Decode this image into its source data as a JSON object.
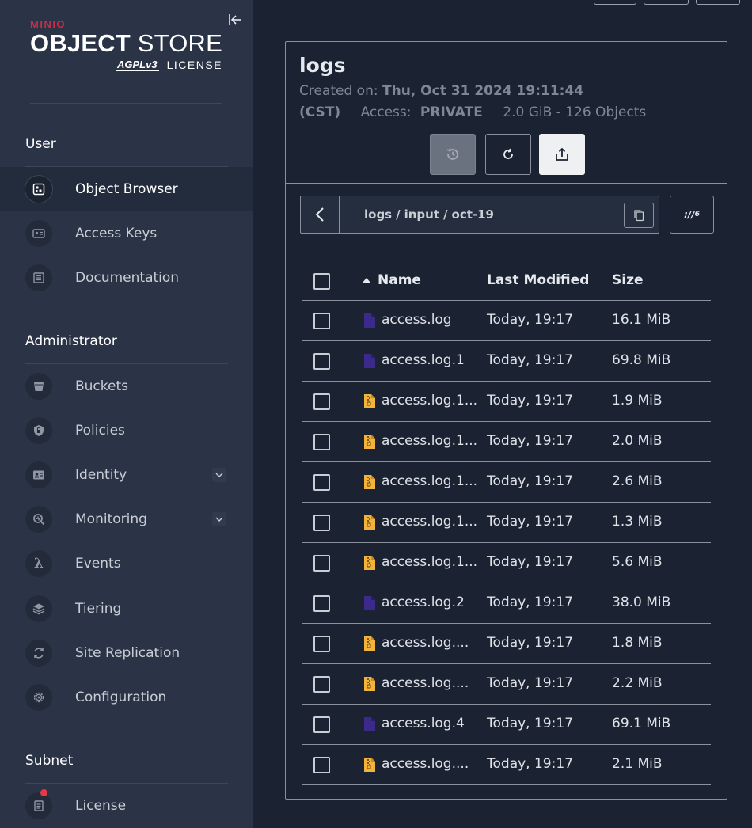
{
  "brand": {
    "vendor": "MINIO",
    "product_bold": "OBJECT",
    "product_rest": " STORE",
    "agpl": "AGPLv3",
    "license_text": "LICENSE"
  },
  "sidebar": {
    "sections": [
      {
        "title": "User",
        "items": [
          {
            "label": "Object Browser",
            "icon": "object-browser-icon",
            "active": true
          },
          {
            "label": "Access Keys",
            "icon": "access-keys-icon"
          },
          {
            "label": "Documentation",
            "icon": "documentation-icon"
          }
        ]
      },
      {
        "title": "Administrator",
        "items": [
          {
            "label": "Buckets",
            "icon": "bucket-icon"
          },
          {
            "label": "Policies",
            "icon": "policies-icon"
          },
          {
            "label": "Identity",
            "icon": "identity-icon",
            "expandable": true
          },
          {
            "label": "Monitoring",
            "icon": "monitoring-icon",
            "expandable": true
          },
          {
            "label": "Events",
            "icon": "lambda-icon"
          },
          {
            "label": "Tiering",
            "icon": "tiering-icon"
          },
          {
            "label": "Site Replication",
            "icon": "site-replication-icon"
          },
          {
            "label": "Configuration",
            "icon": "gear-icon"
          }
        ]
      },
      {
        "title": "Subnet",
        "items": [
          {
            "label": "License",
            "icon": "license-icon",
            "badge": true
          }
        ]
      }
    ]
  },
  "bucket": {
    "name": "logs",
    "created_label": "Created on:",
    "created_value": "Thu, Oct 31 2024 19:11:44",
    "tz": "(CST)",
    "access_label": "Access:",
    "access_value": "PRIVATE",
    "usage": "2.0 GiB - 126 Objects"
  },
  "path": {
    "segments": [
      "logs",
      "input",
      "oct-19"
    ],
    "separator": "/"
  },
  "rewind_label": "://",
  "table": {
    "columns": {
      "name": "Name",
      "modified": "Last Modified",
      "size": "Size"
    },
    "rows": [
      {
        "name": "access.log",
        "type": "file",
        "modified": "Today, 19:17",
        "size": "16.1 MiB"
      },
      {
        "name": "access.log.1",
        "type": "file",
        "modified": "Today, 19:17",
        "size": "69.8 MiB"
      },
      {
        "name": "access.log.1...",
        "type": "archive",
        "modified": "Today, 19:17",
        "size": "1.9 MiB"
      },
      {
        "name": "access.log.1...",
        "type": "archive",
        "modified": "Today, 19:17",
        "size": "2.0 MiB"
      },
      {
        "name": "access.log.1...",
        "type": "archive",
        "modified": "Today, 19:17",
        "size": "2.6 MiB"
      },
      {
        "name": "access.log.1...",
        "type": "archive",
        "modified": "Today, 19:17",
        "size": "1.3 MiB"
      },
      {
        "name": "access.log.1...",
        "type": "archive",
        "modified": "Today, 19:17",
        "size": "5.6 MiB"
      },
      {
        "name": "access.log.2",
        "type": "file",
        "modified": "Today, 19:17",
        "size": "38.0 MiB"
      },
      {
        "name": "access.log....",
        "type": "archive",
        "modified": "Today, 19:17",
        "size": "1.8 MiB"
      },
      {
        "name": "access.log....",
        "type": "archive",
        "modified": "Today, 19:17",
        "size": "2.2 MiB"
      },
      {
        "name": "access.log.4",
        "type": "file",
        "modified": "Today, 19:17",
        "size": "69.1 MiB"
      },
      {
        "name": "access.log....",
        "type": "archive",
        "modified": "Today, 19:17",
        "size": "2.1 MiB"
      }
    ]
  },
  "colors": {
    "sidebar_bg": "#2b3447",
    "main_bg": "#1b2333",
    "brand_red": "#c72c48",
    "file_icon": "#3b2a8c",
    "archive_icon": "#f2b33d",
    "badge": "#e63946"
  }
}
